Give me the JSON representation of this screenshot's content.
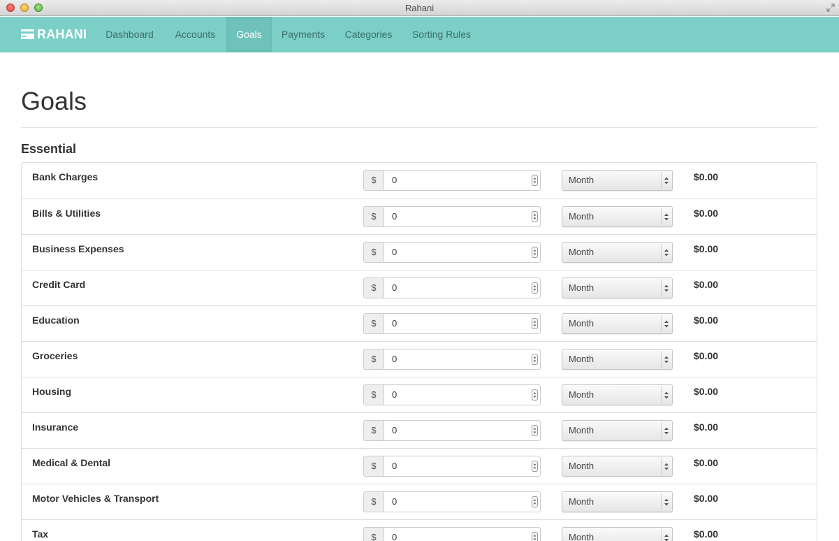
{
  "window": {
    "title": "Rahani"
  },
  "navbar": {
    "brand": "RAHANI",
    "items": [
      {
        "label": "Dashboard"
      },
      {
        "label": "Accounts"
      },
      {
        "label": "Goals",
        "active": true
      },
      {
        "label": "Payments"
      },
      {
        "label": "Categories"
      },
      {
        "label": "Sorting Rules"
      }
    ]
  },
  "page": {
    "title": "Goals",
    "section": "Essential",
    "currency_symbol": "$",
    "rows": [
      {
        "label": "Bank Charges",
        "amount": "0",
        "period": "Month",
        "total": "$0.00"
      },
      {
        "label": "Bills & Utilities",
        "amount": "0",
        "period": "Month",
        "total": "$0.00"
      },
      {
        "label": "Business Expenses",
        "amount": "0",
        "period": "Month",
        "total": "$0.00"
      },
      {
        "label": "Credit Card",
        "amount": "0",
        "period": "Month",
        "total": "$0.00"
      },
      {
        "label": "Education",
        "amount": "0",
        "period": "Month",
        "total": "$0.00"
      },
      {
        "label": "Groceries",
        "amount": "0",
        "period": "Month",
        "total": "$0.00"
      },
      {
        "label": "Housing",
        "amount": "0",
        "period": "Month",
        "total": "$0.00"
      },
      {
        "label": "Insurance",
        "amount": "0",
        "period": "Month",
        "total": "$0.00"
      },
      {
        "label": "Medical & Dental",
        "amount": "0",
        "period": "Month",
        "total": "$0.00"
      },
      {
        "label": "Motor Vehicles & Transport",
        "amount": "0",
        "period": "Month",
        "total": "$0.00"
      },
      {
        "label": "Tax",
        "amount": "0",
        "period": "Month",
        "total": "$0.00"
      }
    ]
  },
  "colors": {
    "navbar": "#7ccfc7",
    "navbar_active": "#6fc2ba",
    "nav_text": "#3a6f6a"
  },
  "icons": {
    "brand": "card-icon",
    "window_close": "close-dot",
    "window_minimize": "minimize-dot",
    "window_zoom": "zoom-dot",
    "fullscreen": "fullscreen-arrows-icon"
  }
}
